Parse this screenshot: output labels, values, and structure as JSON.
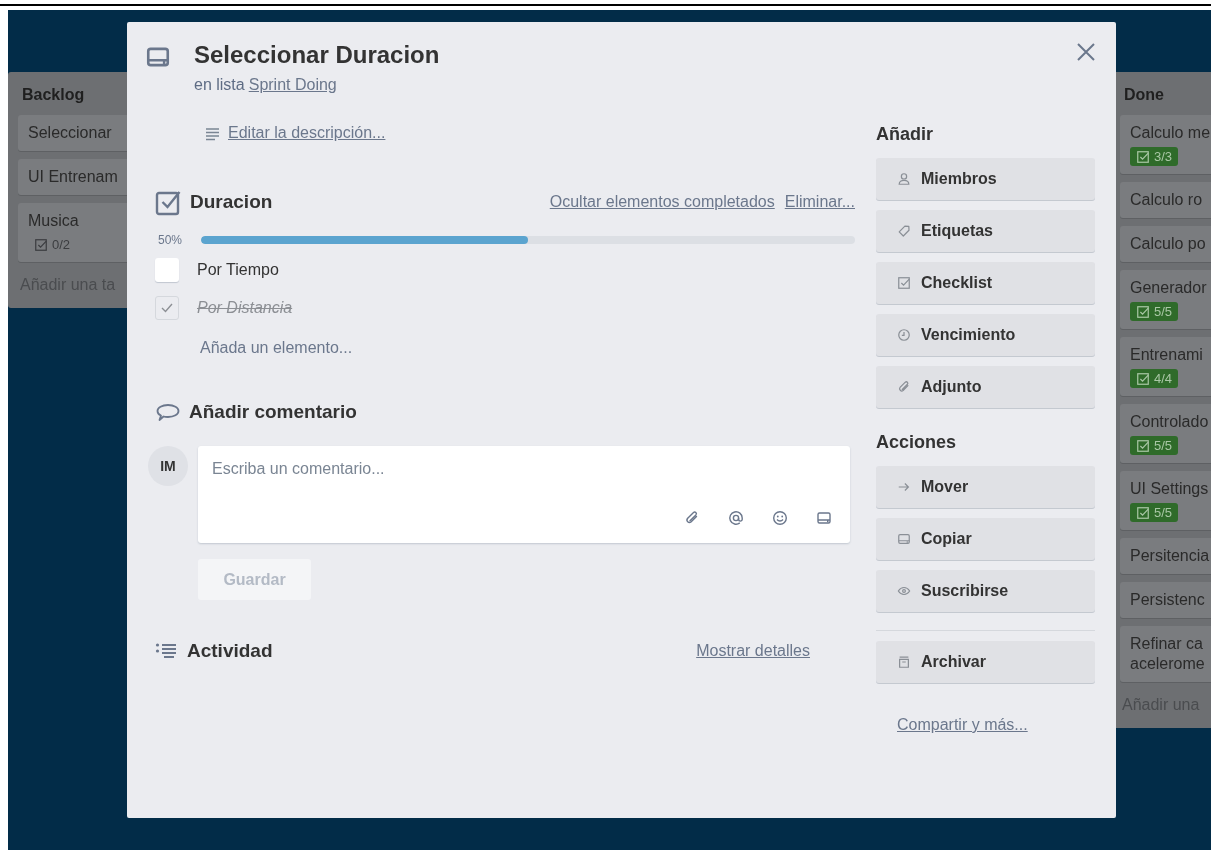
{
  "board": {
    "lists": [
      {
        "title": "Backlog",
        "cards": [
          {
            "title": "Seleccionar"
          },
          {
            "title": "UI Entrenam"
          },
          {
            "title": "Musica",
            "badge": {
              "text": "0/2",
              "complete": false
            }
          }
        ],
        "add_card": "Añadir una ta"
      },
      {
        "title": "Done",
        "cards": [
          {
            "title": "Calculo me",
            "badge": {
              "text": "3/3",
              "complete": true
            }
          },
          {
            "title": "Calculo ro"
          },
          {
            "title": "Calculo po"
          },
          {
            "title": "Generador",
            "badge": {
              "text": "5/5",
              "complete": true
            }
          },
          {
            "title": "Entrenami",
            "badge": {
              "text": "4/4",
              "complete": true
            }
          },
          {
            "title": "Controlado",
            "badge": {
              "text": "5/5",
              "complete": true
            }
          },
          {
            "title": "UI Settings",
            "badge": {
              "text": "5/5",
              "complete": true
            }
          },
          {
            "title": "Persitencia"
          },
          {
            "title": "Persistenc"
          },
          {
            "title": "Refinar ca\nacelerome"
          }
        ],
        "add_card": "Añadir una"
      }
    ]
  },
  "card_dialog": {
    "title": "Seleccionar Duracion",
    "list_prefix": "en lista",
    "list_link": "Sprint Doing",
    "description_link": "Editar la descripción...",
    "checklist": {
      "title": "Duracion",
      "hide_link": "Ocultar elementos completados",
      "delete_link": "Eliminar...",
      "percent": "50%",
      "level": 0.5,
      "items": [
        {
          "text": "Por Tiempo",
          "checked": false
        },
        {
          "text": "Por Distancia",
          "checked": true
        }
      ],
      "add_item": "Añada un elemento..."
    },
    "comment": {
      "title": "Añadir comentario",
      "avatar": "IM",
      "placeholder": "Escriba un comentario...",
      "save_button": {
        "label": "Guardar",
        "disabled": true
      }
    },
    "activity": {
      "title": "Actividad",
      "details_link": "Mostrar detalles"
    },
    "sidebar": {
      "sections": [
        {
          "title": "Añadir",
          "buttons": [
            {
              "label": "Miembros",
              "separated": false
            },
            {
              "label": "Etiquetas",
              "separated": false
            },
            {
              "label": "Checklist",
              "separated": false
            },
            {
              "label": "Vencimiento",
              "separated": false
            },
            {
              "label": "Adjunto",
              "separated": false
            }
          ]
        },
        {
          "title": "Acciones",
          "buttons": [
            {
              "label": "Mover",
              "separated": false
            },
            {
              "label": "Copiar",
              "separated": false
            },
            {
              "label": "Suscribirse",
              "separated": false
            },
            {
              "label": "Archivar",
              "separated": true
            }
          ]
        }
      ],
      "share_link": "Compartir y más..."
    }
  }
}
